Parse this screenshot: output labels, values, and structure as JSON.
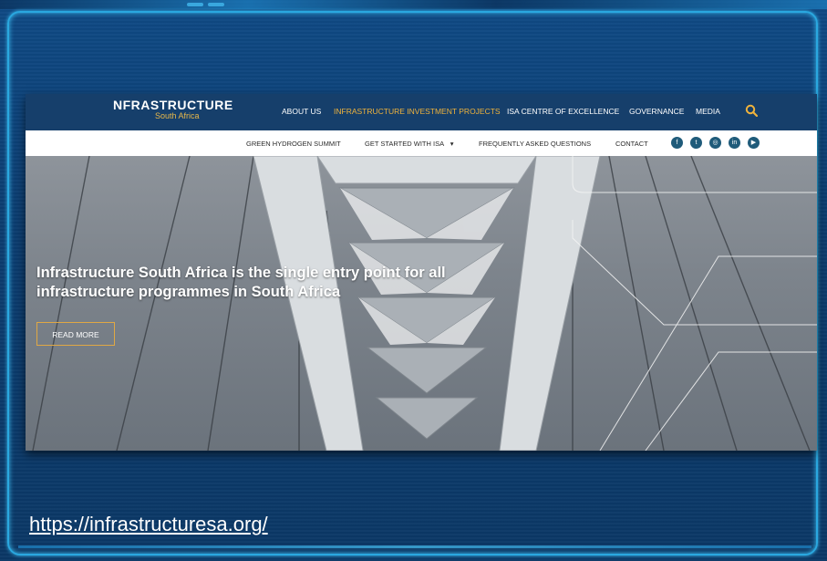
{
  "site": {
    "logo_main": "NFRASTRUCTURE",
    "logo_sub": "South Africa",
    "main_nav": [
      "ABOUT US",
      "INFRASTRUCTURE INVESTMENT PROJECTS",
      "ISA CENTRE OF EXCELLENCE",
      "GOVERNANCE",
      "MEDIA"
    ],
    "sub_nav": [
      "GREEN HYDROGEN SUMMIT",
      "GET STARTED WITH ISA",
      "FREQUENTLY ASKED QUESTIONS",
      "CONTACT"
    ],
    "dropdown_glyph": "▾",
    "social_icons": [
      "facebook-icon",
      "twitter-icon",
      "instagram-icon",
      "linkedin-icon",
      "youtube-icon"
    ],
    "social_glyphs": [
      "f",
      "t",
      "◎",
      "in",
      "▶"
    ],
    "hero_headline": "Infrastructure South Africa is the single entry point for all infrastructure programmes in South Africa",
    "read_more": "READ MORE"
  },
  "caption_url": "https://infrastructuresa.org/",
  "colors": {
    "nav_bg": "#163f6b",
    "accent": "#f0b33c",
    "frame_bg": "#0d3f73",
    "frame_border": "#2aa8e0"
  }
}
